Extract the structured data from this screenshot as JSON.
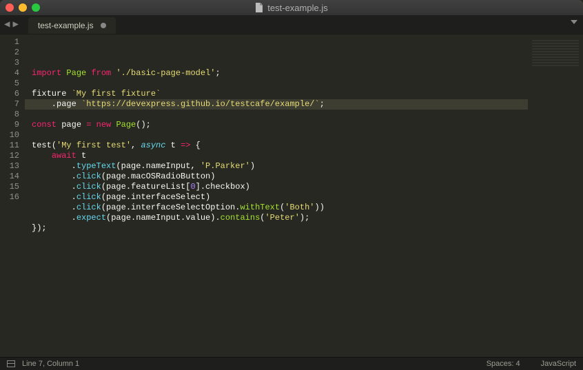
{
  "window": {
    "title": "test-example.js"
  },
  "tabs": [
    {
      "label": "test-example.js",
      "dirty": true
    }
  ],
  "editor": {
    "highlighted_line": 7,
    "lines": [
      {
        "n": 1,
        "tokens": [
          [
            "kw",
            "import"
          ],
          [
            "prop",
            " "
          ],
          [
            "cls",
            "Page"
          ],
          [
            "prop",
            " "
          ],
          [
            "kw",
            "from"
          ],
          [
            "prop",
            " "
          ],
          [
            "str",
            "'./basic-page-model'"
          ],
          [
            "prop",
            ";"
          ]
        ]
      },
      {
        "n": 2,
        "tokens": []
      },
      {
        "n": 3,
        "tokens": [
          [
            "fxkw",
            "fixture "
          ],
          [
            "str",
            "`My first fixture`"
          ]
        ]
      },
      {
        "n": 4,
        "tokens": [
          [
            "prop",
            "    ."
          ],
          [
            "fxkw",
            "page "
          ],
          [
            "str",
            "`https://devexpress.github.io/testcafe/example/`"
          ],
          [
            "prop",
            ";"
          ]
        ]
      },
      {
        "n": 5,
        "tokens": []
      },
      {
        "n": 6,
        "tokens": [
          [
            "kw",
            "const"
          ],
          [
            "prop",
            " "
          ],
          [
            "var",
            "page"
          ],
          [
            "prop",
            " "
          ],
          [
            "kw",
            "="
          ],
          [
            "prop",
            " "
          ],
          [
            "kw",
            "new"
          ],
          [
            "prop",
            " "
          ],
          [
            "cls",
            "Page"
          ],
          [
            "prop",
            "();"
          ]
        ]
      },
      {
        "n": 7,
        "tokens": []
      },
      {
        "n": 8,
        "tokens": [
          [
            "fxkw",
            "test"
          ],
          [
            "prop",
            "("
          ],
          [
            "str",
            "'My first test'"
          ],
          [
            "prop",
            ", "
          ],
          [
            "kw2",
            "async"
          ],
          [
            "prop",
            " "
          ],
          [
            "var",
            "t"
          ],
          [
            "prop",
            " "
          ],
          [
            "kw",
            "=>"
          ],
          [
            "prop",
            " {"
          ]
        ]
      },
      {
        "n": 9,
        "tokens": [
          [
            "prop",
            "    "
          ],
          [
            "kw",
            "await"
          ],
          [
            "prop",
            " t"
          ]
        ]
      },
      {
        "n": 10,
        "tokens": [
          [
            "prop",
            "        ."
          ],
          [
            "fn",
            "typeText"
          ],
          [
            "prop",
            "(page.nameInput, "
          ],
          [
            "str",
            "'P.Parker'"
          ],
          [
            "prop",
            ")"
          ]
        ]
      },
      {
        "n": 11,
        "tokens": [
          [
            "prop",
            "        ."
          ],
          [
            "fn",
            "click"
          ],
          [
            "prop",
            "(page.macOSRadioButton)"
          ]
        ]
      },
      {
        "n": 12,
        "tokens": [
          [
            "prop",
            "        ."
          ],
          [
            "fn",
            "click"
          ],
          [
            "prop",
            "(page.featureList["
          ],
          [
            "num",
            "0"
          ],
          [
            "prop",
            "].checkbox)"
          ]
        ]
      },
      {
        "n": 13,
        "tokens": [
          [
            "prop",
            "        ."
          ],
          [
            "fn",
            "click"
          ],
          [
            "prop",
            "(page.interfaceSelect)"
          ]
        ]
      },
      {
        "n": 14,
        "tokens": [
          [
            "prop",
            "        ."
          ],
          [
            "fn",
            "click"
          ],
          [
            "prop",
            "(page.interfaceSelectOption."
          ],
          [
            "fn2",
            "withText"
          ],
          [
            "prop",
            "("
          ],
          [
            "str",
            "'Both'"
          ],
          [
            "prop",
            "))"
          ]
        ]
      },
      {
        "n": 15,
        "tokens": [
          [
            "prop",
            "        ."
          ],
          [
            "fn",
            "expect"
          ],
          [
            "prop",
            "(page.nameInput.value)."
          ],
          [
            "fn2",
            "contains"
          ],
          [
            "prop",
            "("
          ],
          [
            "str",
            "'Peter'"
          ],
          [
            "prop",
            ");"
          ]
        ]
      },
      {
        "n": 16,
        "tokens": [
          [
            "prop",
            "});"
          ]
        ]
      }
    ]
  },
  "status": {
    "cursor": "Line 7, Column 1",
    "indent": "Spaces: 4",
    "language": "JavaScript"
  }
}
